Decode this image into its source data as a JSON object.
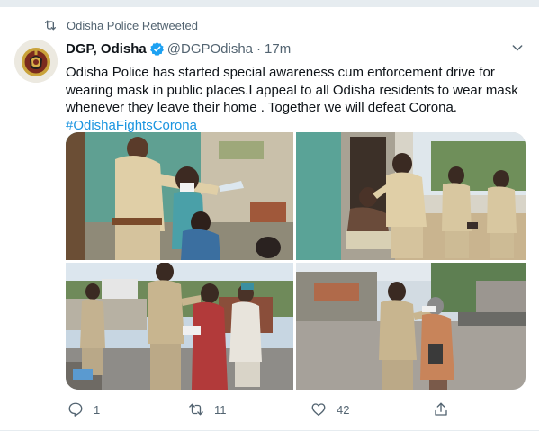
{
  "retweet_label": "Odisha Police Retweeted",
  "tweet": {
    "display_name": "DGP, Odisha",
    "handle": "@DGPOdisha",
    "separator": "·",
    "time": "17m",
    "text_lines": [
      "Odisha Police has started special awareness cum enforcement drive for",
      "wearing  mask in public places.I appeal to all Odisha residents to wear mask",
      "whenever they leave their home . Together we will  defeat Corona."
    ],
    "hashtag": "#OdishaFightsCorona"
  },
  "actions": {
    "reply_count": "1",
    "retweet_count": "11",
    "like_count": "42"
  },
  "colors": {
    "link": "#1b95e0",
    "muted": "#536471",
    "verified": "#1da1f2",
    "separator_strip": "#e6ecf0"
  },
  "icons": {
    "retweet_header": "retweet-icon",
    "verified": "verified-badge-icon",
    "menu": "chevron-down-icon",
    "reply": "reply-icon",
    "retweet": "retweet-icon",
    "like": "heart-icon",
    "share": "share-icon"
  }
}
